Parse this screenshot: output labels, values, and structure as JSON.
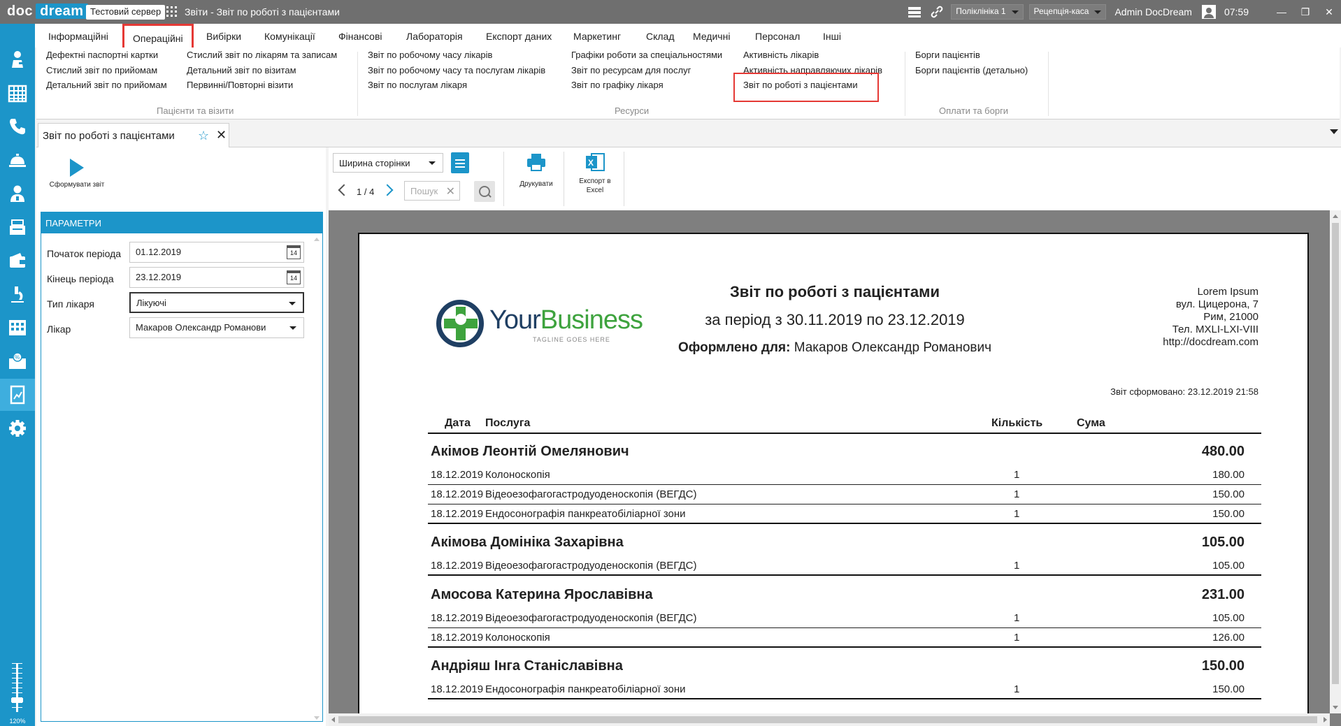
{
  "titlebar": {
    "logo_doc": "doc",
    "logo_dream": "dream",
    "server": "Тестовий сервер",
    "title": "Звіти - Звіт по роботі з пацієнтами",
    "clinic": "Поліклініка 1",
    "role": "Рецепція-каса",
    "user": "Admin DocDream",
    "time": "07:59"
  },
  "ribbon": {
    "tabs": [
      "Інформаційні",
      "Операційні",
      "Вибірки",
      "Комунікації",
      "Фінансові",
      "Лабораторія",
      "Експорт даних",
      "Маркетинг",
      "Склад",
      "Медичні",
      "Персонал",
      "Інші"
    ],
    "active_tab": "Операційні",
    "groups": {
      "patients": {
        "title": "Пацієнти та візити",
        "col1": [
          "Дефектні паспортні картки",
          "Стислий звіт по прийомам",
          "Детальний звіт по прийомам"
        ],
        "col2": [
          "Стислий звіт по лікарям та записам",
          "Детальний звіт по візитам",
          "Первинні/Повторні візити"
        ]
      },
      "resources": {
        "title": "Ресурси",
        "col1": [
          "Звіт по робочому часу лікарів",
          "Звіт по робочому часу та послугам лікарів",
          "Звіт по послугам лікаря"
        ],
        "col2": [
          "Графіки роботи за спеціальностями",
          "Звіт по ресурсам для послуг",
          "Звіт по графіку лікаря"
        ],
        "col3": [
          "Активність лікарів",
          "Активність направляючих лікарів",
          "Звіт по роботі з пацієнтами"
        ]
      },
      "payments": {
        "title": "Оплати та борги",
        "col1": [
          "Борги пацієнтів",
          "Борги пацієнтів (детально)"
        ]
      }
    }
  },
  "doc_tab": {
    "label": "Звіт по роботі з пацієнтами"
  },
  "left": {
    "generate_label": "Сформувати звіт",
    "params_title": "ПАРАМЕТРИ",
    "start_label": "Початок періода",
    "start_value": "01.12.2019",
    "end_label": "Кінець періода",
    "end_value": "23.12.2019",
    "doctor_type_label": "Тип лікаря",
    "doctor_type_value": "Лікуючі",
    "doctor_label": "Лікар",
    "doctor_value": "Макаров Олександр Романови",
    "cal_day": "14"
  },
  "report_toolbar": {
    "page_width": "Ширина сторінки",
    "page_indicator": "1 / 4",
    "search_placeholder": "Пошук",
    "print_label": "Друкувати",
    "export_label": "Експорт в Excel"
  },
  "report": {
    "title": "Звіт по роботі з пацієнтами",
    "period": "за період з 30.11.2019 по 23.12.2019",
    "for_label": "Оформлено для:",
    "for_value": "Макаров Олександр Романович",
    "address": [
      "Lorem Ipsum",
      "вул. Цицерона, 7",
      "Рим, 21000",
      "Тел. MXLI-LXI-VIII",
      "http://docdream.com"
    ],
    "generated": "Звіт сформовано: 23.12.2019 21:58",
    "brand_name_1": "Your",
    "brand_name_2": "Business",
    "brand_tagline": "TAGLINE GOES HERE",
    "columns": {
      "date": "Дата",
      "service": "Послуга",
      "qty": "Кількість",
      "sum": "Сума"
    },
    "patients": [
      {
        "name": "Акімов Леонтій Омелянович",
        "total": "480.00",
        "rows": [
          {
            "date": "18.12.2019",
            "service": "Колоноскопія",
            "qty": "1",
            "sum": "180.00"
          },
          {
            "date": "18.12.2019",
            "service": "Відеоезофагогастродуоденоскопія (ВЕГДС)",
            "qty": "1",
            "sum": "150.00"
          },
          {
            "date": "18.12.2019",
            "service": "Ендосонографія панкреатобіліарної зони",
            "qty": "1",
            "sum": "150.00"
          }
        ]
      },
      {
        "name": "Акімова Домініка Захарівна",
        "total": "105.00",
        "rows": [
          {
            "date": "18.12.2019",
            "service": "Відеоезофагогастродуоденоскопія (ВЕГДС)",
            "qty": "1",
            "sum": "105.00"
          }
        ]
      },
      {
        "name": "Амосова Катерина Ярославівна",
        "total": "231.00",
        "rows": [
          {
            "date": "18.12.2019",
            "service": "Відеоезофагогастродуоденоскопія (ВЕГДС)",
            "qty": "1",
            "sum": "105.00"
          },
          {
            "date": "18.12.2019",
            "service": "Колоноскопія",
            "qty": "1",
            "sum": "126.00"
          }
        ]
      },
      {
        "name": "Андріяш Інга Станіславівна",
        "total": "150.00",
        "rows": [
          {
            "date": "18.12.2019",
            "service": "Ендосонографія панкреатобіліарної зони",
            "qty": "1",
            "sum": "150.00"
          }
        ]
      }
    ]
  },
  "zoom": "120%",
  "colors": {
    "accent": "#1c95c9",
    "highlight": "#e53935",
    "titlebar": "#6f6f6f"
  }
}
